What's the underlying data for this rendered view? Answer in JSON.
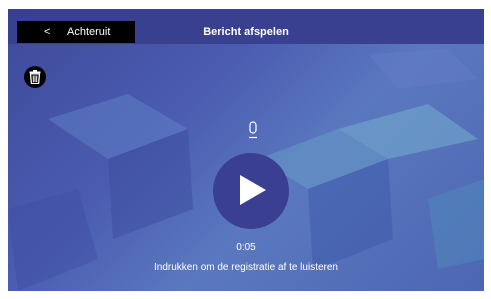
{
  "header": {
    "back_arrow": "<",
    "back_label": "Achteruit",
    "title": "Bericht afspelen"
  },
  "player": {
    "time": "0:05",
    "hint": "Indrukken om de registratie af te luisteren"
  },
  "icons": {
    "delete": "trash-icon",
    "microphone": "microphone-icon",
    "play": "play-icon"
  },
  "colors": {
    "header_bg": "#38408f",
    "play_button_bg": "#3a3f91",
    "back_button_bg": "#000000",
    "text": "#ffffff"
  }
}
